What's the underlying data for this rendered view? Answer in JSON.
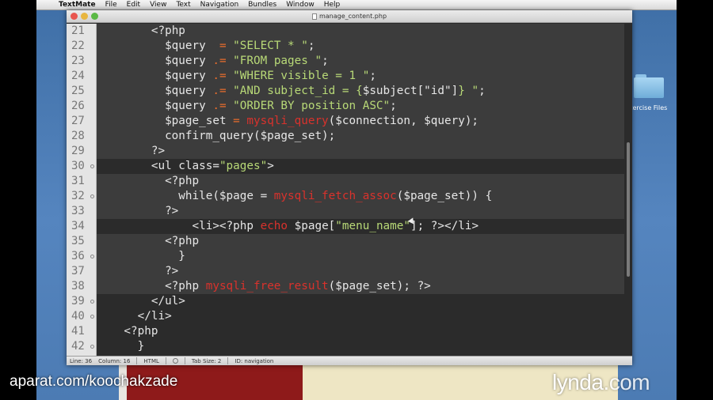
{
  "menubar": {
    "apple": "",
    "items": [
      "TextMate",
      "File",
      "Edit",
      "View",
      "Text",
      "Navigation",
      "Bundles",
      "Window",
      "Help"
    ]
  },
  "window": {
    "title": "manage_content.php"
  },
  "desktop": {
    "folder_label": "xercise Files"
  },
  "editor": {
    "lines": [
      {
        "n": "21",
        "fold": false,
        "bg": "emb",
        "segs": [
          [
            "pl",
            "        "
          ],
          [
            "php",
            "<?php"
          ]
        ]
      },
      {
        "n": "22",
        "fold": false,
        "bg": "emb",
        "segs": [
          [
            "pl",
            "          "
          ],
          [
            "var",
            "$query"
          ],
          [
            "op",
            "  = "
          ],
          [
            "str",
            "\"SELECT * \""
          ],
          [
            "pl",
            ";"
          ]
        ]
      },
      {
        "n": "23",
        "fold": false,
        "bg": "emb",
        "segs": [
          [
            "pl",
            "          "
          ],
          [
            "var",
            "$query"
          ],
          [
            "op",
            " .= "
          ],
          [
            "str",
            "\"FROM pages \""
          ],
          [
            "pl",
            ";"
          ]
        ]
      },
      {
        "n": "24",
        "fold": false,
        "bg": "emb",
        "segs": [
          [
            "pl",
            "          "
          ],
          [
            "var",
            "$query"
          ],
          [
            "op",
            " .= "
          ],
          [
            "str",
            "\"WHERE visible = 1 \""
          ],
          [
            "pl",
            ";"
          ]
        ]
      },
      {
        "n": "25",
        "fold": false,
        "bg": "emb",
        "segs": [
          [
            "pl",
            "          "
          ],
          [
            "var",
            "$query"
          ],
          [
            "op",
            " .= "
          ],
          [
            "str",
            "\"AND subject_id = {"
          ],
          [
            "var",
            "$subject[\"id\"]"
          ],
          [
            "str",
            "} \""
          ],
          [
            "pl",
            ";"
          ]
        ]
      },
      {
        "n": "26",
        "fold": false,
        "bg": "emb",
        "segs": [
          [
            "pl",
            "          "
          ],
          [
            "var",
            "$query"
          ],
          [
            "op",
            " .= "
          ],
          [
            "str",
            "\"ORDER BY position ASC\""
          ],
          [
            "pl",
            ";"
          ]
        ]
      },
      {
        "n": "27",
        "fold": false,
        "bg": "emb",
        "segs": [
          [
            "pl",
            "          "
          ],
          [
            "var",
            "$page_set"
          ],
          [
            "op",
            " = "
          ],
          [
            "fn",
            "mysqli_query"
          ],
          [
            "pl",
            "($connection, $query);"
          ]
        ]
      },
      {
        "n": "28",
        "fold": false,
        "bg": "emb",
        "segs": [
          [
            "pl",
            "          confirm_query($page_set);"
          ]
        ]
      },
      {
        "n": "29",
        "fold": false,
        "bg": "emb",
        "segs": [
          [
            "pl",
            "        ?>"
          ]
        ]
      },
      {
        "n": "30",
        "fold": true,
        "bg": "html",
        "segs": [
          [
            "pl",
            "        <ul class="
          ],
          [
            "str",
            "\"pages\""
          ],
          [
            "pl",
            ">"
          ]
        ]
      },
      {
        "n": "31",
        "fold": false,
        "bg": "emb",
        "segs": [
          [
            "pl",
            "          <?php"
          ]
        ]
      },
      {
        "n": "32",
        "fold": true,
        "bg": "emb",
        "segs": [
          [
            "pl",
            "            while($page = "
          ],
          [
            "fn",
            "mysqli_fetch_assoc"
          ],
          [
            "pl",
            "($page_set)) {"
          ]
        ]
      },
      {
        "n": "33",
        "fold": false,
        "bg": "emb",
        "segs": [
          [
            "pl",
            "          ?>"
          ]
        ]
      },
      {
        "n": "34",
        "fold": false,
        "bg": "html",
        "segs": [
          [
            "pl",
            "              <li><?php "
          ],
          [
            "fn",
            "echo"
          ],
          [
            "pl",
            " $page["
          ],
          [
            "str",
            "\"menu_name\""
          ],
          [
            "pl",
            "]; ?></li>"
          ]
        ]
      },
      {
        "n": "35",
        "fold": false,
        "bg": "emb",
        "segs": [
          [
            "pl",
            "          <?php"
          ]
        ]
      },
      {
        "n": "36",
        "fold": true,
        "bg": "emb",
        "segs": [
          [
            "pl",
            "            }"
          ]
        ]
      },
      {
        "n": "37",
        "fold": false,
        "bg": "emb",
        "segs": [
          [
            "pl",
            "          ?>"
          ]
        ]
      },
      {
        "n": "38",
        "fold": false,
        "bg": "emb",
        "segs": [
          [
            "pl",
            "          <?php "
          ],
          [
            "fn",
            "mysqli_free_result"
          ],
          [
            "pl",
            "($page_set); ?>"
          ]
        ]
      },
      {
        "n": "39",
        "fold": true,
        "bg": "html",
        "segs": [
          [
            "pl",
            "        </ul>"
          ]
        ]
      },
      {
        "n": "40",
        "fold": true,
        "bg": "html",
        "segs": [
          [
            "pl",
            "      </li>"
          ]
        ]
      },
      {
        "n": "41",
        "fold": false,
        "bg": "html",
        "segs": [
          [
            "pl",
            "    <?php"
          ]
        ]
      },
      {
        "n": "42",
        "fold": true,
        "bg": "html",
        "segs": [
          [
            "pl",
            "      }"
          ]
        ]
      }
    ]
  },
  "statusbar": {
    "line": "Line: 36",
    "column": "Column: 16",
    "language": "HTML",
    "tab_size": "Tab Size:  2",
    "symbol": "ID: navigation"
  },
  "watermarks": {
    "left": "aparat.com/koochakzade",
    "right_brand": "lynda",
    "right_suffix": ".com"
  }
}
